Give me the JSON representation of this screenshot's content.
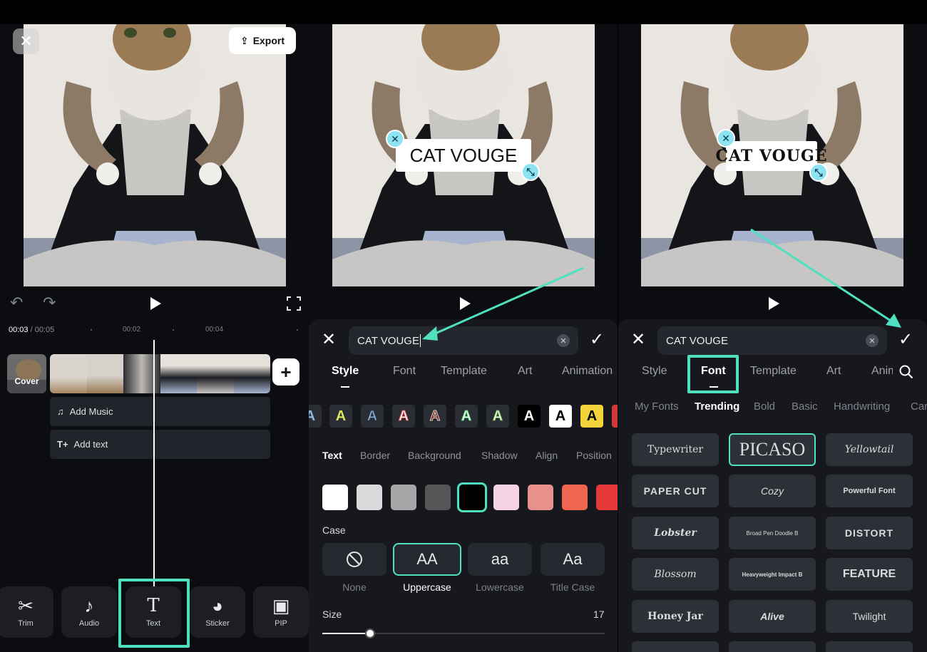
{
  "left": {
    "export_label": "Export",
    "time_current": "00:03",
    "time_total": "/ 00:05",
    "ruler": [
      "00:02",
      "00:04"
    ],
    "cover_label": "Cover",
    "tracks": {
      "music": "Add Music",
      "text": "Add text"
    },
    "tools": [
      {
        "label": "Trim",
        "icon": "scissors-icon"
      },
      {
        "label": "Audio",
        "icon": "music-note-icon"
      },
      {
        "label": "Text",
        "icon": "text-icon"
      },
      {
        "label": "Sticker",
        "icon": "sticker-icon"
      },
      {
        "label": "PIP",
        "icon": "pip-icon"
      }
    ]
  },
  "middle": {
    "overlay_text": "CAT VOUGE",
    "input_value": "CAT VOUGE",
    "tabs": [
      "Style",
      "Font",
      "Template",
      "Art",
      "Animation"
    ],
    "active_tab": "Style",
    "subtabs": [
      "Text",
      "Border",
      "Background",
      "Shadow",
      "Align",
      "Position"
    ],
    "presets": [
      "A",
      "A",
      "A",
      "A",
      "A",
      "A",
      "A",
      "A",
      "A",
      "A"
    ],
    "swatches": [
      "#ffffff",
      "#d9d9d9",
      "#a6a6a6",
      "#555555",
      "#000000",
      "#f6d3e3",
      "#e8908a",
      "#ee6650",
      "#e63a3a"
    ],
    "case_label": "Case",
    "case_options": [
      {
        "glyph": "⃠",
        "label": "None"
      },
      {
        "glyph": "AA",
        "label": "Uppercase"
      },
      {
        "glyph": "aa",
        "label": "Lowercase"
      },
      {
        "glyph": "Aa",
        "label": "Title Case"
      }
    ],
    "size_label": "Size",
    "size_value": "17",
    "size_fraction": 0.17
  },
  "right": {
    "overlay_text": "CAT VOUGE",
    "input_value": "CAT VOUGE",
    "tabs": [
      "Style",
      "Font",
      "Template",
      "Art",
      "Anim"
    ],
    "active_tab": "Font",
    "font_categories": [
      "My Fonts",
      "Trending",
      "Bold",
      "Basic",
      "Handwriting",
      "Cart"
    ],
    "active_category": "Trending",
    "fonts": [
      "Typewriter",
      "PICASO",
      "Yellowtail",
      "PAPER CUT",
      "Cozy",
      "Powerful Font",
      "Lobster",
      "Broad Pen Doodle B",
      "DISTORT",
      "Blossom",
      "Heavyweight Impact B",
      "FEATURE",
      "Honey Jar",
      "Alive",
      "Twilight"
    ],
    "selected_font": "PICASO"
  },
  "colors": {
    "accent": "#4fe0c0",
    "handle": "#8de3f2",
    "panel_bg": "#0c0d11",
    "sheet_bg": "#17181d"
  }
}
